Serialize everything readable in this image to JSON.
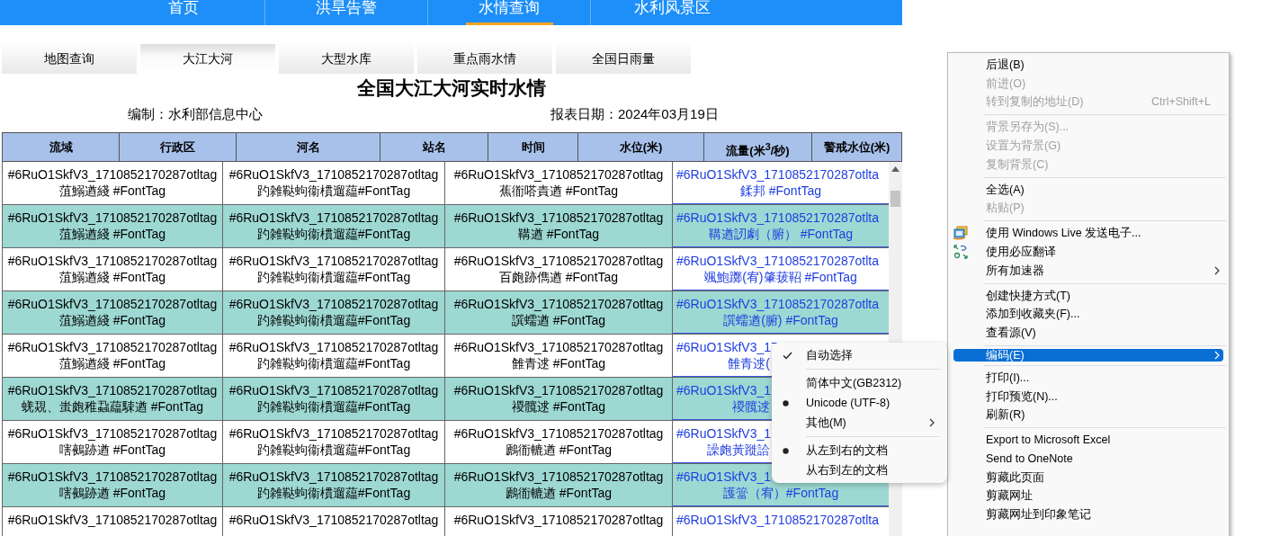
{
  "nav": [
    {
      "label": "首页",
      "selected": false
    },
    {
      "label": "洪旱告警",
      "selected": false
    },
    {
      "label": "水情查询",
      "selected": true
    },
    {
      "label": "水利风景区",
      "selected": false
    }
  ],
  "subtabs": [
    {
      "label": "地图查询",
      "selected": false
    },
    {
      "label": "大江大河",
      "selected": true
    },
    {
      "label": "大型水库",
      "selected": false
    },
    {
      "label": "重点雨水情",
      "selected": false
    },
    {
      "label": "全国日雨量",
      "selected": false
    }
  ],
  "report": {
    "title": "全国大江大河实时水情",
    "compiler": "编制：水利部信息中心",
    "date": "报表日期：2024年03月19日"
  },
  "table_header": {
    "labels": [
      "流域",
      "行政区",
      "河名",
      "站名",
      "时间",
      "水位(米)",
      "流量(米$^{3}$/秒)",
      "警戒水位(米)"
    ]
  },
  "table_body": {
    "rows": [
      {
        "shaded": false,
        "cells": [
          {
            "kind": "text",
            "lines": [
              "#6RuO1SkfV3_1710852170287otltag",
              "菹鰯遒綫 #FontTag"
            ]
          },
          {
            "kind": "text",
            "lines": [
              "#6RuO1SkfV3_1710852170287otltag",
              "趵雑鞑蚼衞樌遛藴#FontTag"
            ]
          },
          {
            "kind": "text",
            "lines": [
              "#6RuO1SkfV3_1710852170287otltag",
              "蕉衜嗒責遒 #FontTag"
            ]
          },
          {
            "kind": "link",
            "lines": [
              "#6RuO1SkfV3_1710852170287otlta",
              "鍒邦 #FontTag"
            ]
          }
        ]
      },
      {
        "shaded": true,
        "cells": [
          {
            "kind": "text",
            "lines": [
              "#6RuO1SkfV3_1710852170287otltag",
              "菹鰯遒綫 #FontTag"
            ]
          },
          {
            "kind": "text",
            "lines": [
              "#6RuO1SkfV3_1710852170287otltag",
              "趵雑鞑蚼衞樌遛藴#FontTag"
            ]
          },
          {
            "kind": "text",
            "lines": [
              "#6RuO1SkfV3_1710852170287otltag",
              "鞲遒 #FontTag"
            ]
          },
          {
            "kind": "link",
            "lines": [
              "#6RuO1SkfV3_1710852170287otlta",
              "鞲遒訒劇（腑） #FontTag"
            ]
          }
        ]
      },
      {
        "shaded": false,
        "cells": [
          {
            "kind": "text",
            "lines": [
              "#6RuO1SkfV3_1710852170287otltag",
              "菹鰯遒綫 #FontTag"
            ]
          },
          {
            "kind": "text",
            "lines": [
              "#6RuO1SkfV3_1710852170287otltag",
              "趵雑鞑蚼衞樌遛藴#FontTag"
            ]
          },
          {
            "kind": "text",
            "lines": [
              "#6RuO1SkfV3_1710852170287otltag",
              "百皰跡儁遒 #FontTag"
            ]
          },
          {
            "kind": "link",
            "lines": [
              "#6RuO1SkfV3_1710852170287otlta",
              "颯鮑躑(宥)肇菝鞀 #FontTag"
            ]
          }
        ]
      },
      {
        "shaded": true,
        "cells": [
          {
            "kind": "text",
            "lines": [
              "#6RuO1SkfV3_1710852170287otltag",
              "菹鰯遒綫 #FontTag"
            ]
          },
          {
            "kind": "text",
            "lines": [
              "#6RuO1SkfV3_1710852170287otltag",
              "趵雑鞑蚼衞樌遛藴#FontTag"
            ]
          },
          {
            "kind": "text",
            "lines": [
              "#6RuO1SkfV3_1710852170287otltag",
              "譔蠕遒 #FontTag"
            ]
          },
          {
            "kind": "link",
            "lines": [
              "#6RuO1SkfV3_1710852170287otlta",
              "譔蠕遒(腑) #FontTag"
            ]
          }
        ]
      },
      {
        "shaded": false,
        "cells": [
          {
            "kind": "text",
            "lines": [
              "#6RuO1SkfV3_1710852170287otltag",
              "菹鰯遒綫 #FontTag"
            ]
          },
          {
            "kind": "text",
            "lines": [
              "#6RuO1SkfV3_1710852170287otltag",
              "趵雑鞑蚼衞樌遛藴#FontTag"
            ]
          },
          {
            "kind": "text",
            "lines": [
              "#6RuO1SkfV3_1710852170287otltag",
              "雔青逑 #FontTag"
            ]
          },
          {
            "kind": "link_covered",
            "lines": [
              "#6RuO1SkfV3_17",
              "雔青逑("
            ]
          }
        ]
      },
      {
        "shaded": true,
        "cells": [
          {
            "kind": "text",
            "lines": [
              "#6RuO1SkfV3_1710852170287otltag",
              "蜣覝、蚩皰稚蝨藴駷遒 #FontTag"
            ]
          },
          {
            "kind": "text",
            "lines": [
              "#6RuO1SkfV3_1710852170287otltag",
              "趵雑鞑蚼衞樌遛藴#FontTag"
            ]
          },
          {
            "kind": "text",
            "lines": [
              "#6RuO1SkfV3_1710852170287otltag",
              "禝髖逑 #FontTag"
            ]
          },
          {
            "kind": "link_covered",
            "lines": [
              "#6RuO1SkfV3_1",
              "禝髖逑"
            ]
          }
        ]
      },
      {
        "shaded": false,
        "cells": [
          {
            "kind": "text",
            "lines": [
              "#6RuO1SkfV3_1710852170287otltag",
              "嗐鵺跡遒 #FontTag"
            ]
          },
          {
            "kind": "text",
            "lines": [
              "#6RuO1SkfV3_1710852170287otltag",
              "趵雑鞑蚼衞樌遛藴#FontTag"
            ]
          },
          {
            "kind": "text",
            "lines": [
              "#6RuO1SkfV3_1710852170287otltag",
              "鷉衜轆遒 #FontTag"
            ]
          },
          {
            "kind": "link_covered",
            "lines": [
              "#6RuO1SkfV3_1",
              "譟皰黃蹝詥"
            ]
          }
        ]
      },
      {
        "shaded": true,
        "cells": [
          {
            "kind": "text",
            "lines": [
              "#6RuO1SkfV3_1710852170287otltag",
              "嗐鵺跡遒 #FontTag"
            ]
          },
          {
            "kind": "text",
            "lines": [
              "#6RuO1SkfV3_1710852170287otltag",
              "趵雑鞑蚼衞樌遛藴#FontTag"
            ]
          },
          {
            "kind": "text",
            "lines": [
              "#6RuO1SkfV3_1710852170287otltag",
              "鷉衜轆遒 #FontTag"
            ]
          },
          {
            "kind": "link",
            "lines": [
              "#6RuO1SkfV3_1",
              "護簹（宥）#FontTag"
            ]
          }
        ]
      },
      {
        "shaded": false,
        "cells": [
          {
            "kind": "text",
            "lines": [
              "#6RuO1SkfV3_1710852170287otltag"
            ]
          },
          {
            "kind": "text",
            "lines": [
              "#6RuO1SkfV3_1710852170287otltag"
            ]
          },
          {
            "kind": "text",
            "lines": [
              "#6RuO1SkfV3_1710852170287otltag"
            ]
          },
          {
            "kind": "link",
            "lines": [
              "#6RuO1SkfV3_1710852170287otlta"
            ]
          }
        ]
      }
    ]
  },
  "context_menu": {
    "items": [
      {
        "kind": "item",
        "label": "后退(B)",
        "disabled": false,
        "selected": false
      },
      {
        "kind": "item",
        "label": "前进(O)",
        "disabled": true,
        "selected": false
      },
      {
        "kind": "item",
        "label": "转到复制的地址(D)",
        "disabled": true,
        "selected": false,
        "shortcut": "Ctrl+Shift+L"
      },
      {
        "kind": "separator"
      },
      {
        "kind": "item",
        "label": "背景另存为(S)...",
        "disabled": true,
        "selected": false
      },
      {
        "kind": "item",
        "label": "设置为背景(G)",
        "disabled": true,
        "selected": false
      },
      {
        "kind": "item",
        "label": "复制背景(C)",
        "disabled": true,
        "selected": false
      },
      {
        "kind": "separator"
      },
      {
        "kind": "item",
        "label": "全选(A)",
        "disabled": false,
        "selected": false
      },
      {
        "kind": "item",
        "label": "粘贴(P)",
        "disabled": true,
        "selected": false
      },
      {
        "kind": "separator"
      },
      {
        "kind": "icon_item",
        "label": "使用 Windows Live 发送电子...",
        "disabled": false,
        "selected": false
      },
      {
        "kind": "icon_item",
        "label": "使用必应翻译",
        "disabled": false,
        "selected": false
      },
      {
        "kind": "item",
        "label": "所有加速器",
        "disabled": false,
        "selected": false,
        "submenu": true
      },
      {
        "kind": "separator"
      },
      {
        "kind": "item",
        "label": "创建快捷方式(T)",
        "disabled": false,
        "selected": false
      },
      {
        "kind": "item",
        "label": "添加到收藏夹(F)...",
        "disabled": false,
        "selected": false
      },
      {
        "kind": "item",
        "label": "查看源(V)",
        "disabled": false,
        "selected": false
      },
      {
        "kind": "separator"
      },
      {
        "kind": "item",
        "label": "编码(E)",
        "disabled": false,
        "selected": true,
        "submenu": true
      },
      {
        "kind": "separator"
      },
      {
        "kind": "item",
        "label": "打印(I)...",
        "disabled": false,
        "selected": false
      },
      {
        "kind": "item",
        "label": "打印预览(N)...",
        "disabled": false,
        "selected": false
      },
      {
        "kind": "item",
        "label": "刷新(R)",
        "disabled": false,
        "selected": false
      },
      {
        "kind": "separator"
      },
      {
        "kind": "item",
        "label": "Export to Microsoft Excel",
        "disabled": false,
        "selected": false
      },
      {
        "kind": "item",
        "label": "Send to OneNote",
        "disabled": false,
        "selected": false
      },
      {
        "kind": "item",
        "label": "剪藏此页面",
        "disabled": false,
        "selected": false
      },
      {
        "kind": "item",
        "label": "剪藏网址",
        "disabled": false,
        "selected": false
      },
      {
        "kind": "item",
        "label": "剪藏网址到印象笔记",
        "disabled": false,
        "selected": false
      }
    ]
  },
  "encoding_submenu": {
    "items": [
      {
        "kind": "check",
        "label": "自动选择",
        "checked": true
      },
      {
        "kind": "separator"
      },
      {
        "kind": "radio",
        "label": "简体中文(GB2312)",
        "checked": false
      },
      {
        "kind": "radio",
        "label": "Unicode (UTF-8)",
        "checked": true
      },
      {
        "kind": "submenu",
        "label": "其他(M)"
      },
      {
        "kind": "separator"
      },
      {
        "kind": "radio",
        "label": "从左到右的文档",
        "checked": true
      },
      {
        "kind": "radio",
        "label": "从右到左的文档",
        "checked": false
      }
    ]
  }
}
